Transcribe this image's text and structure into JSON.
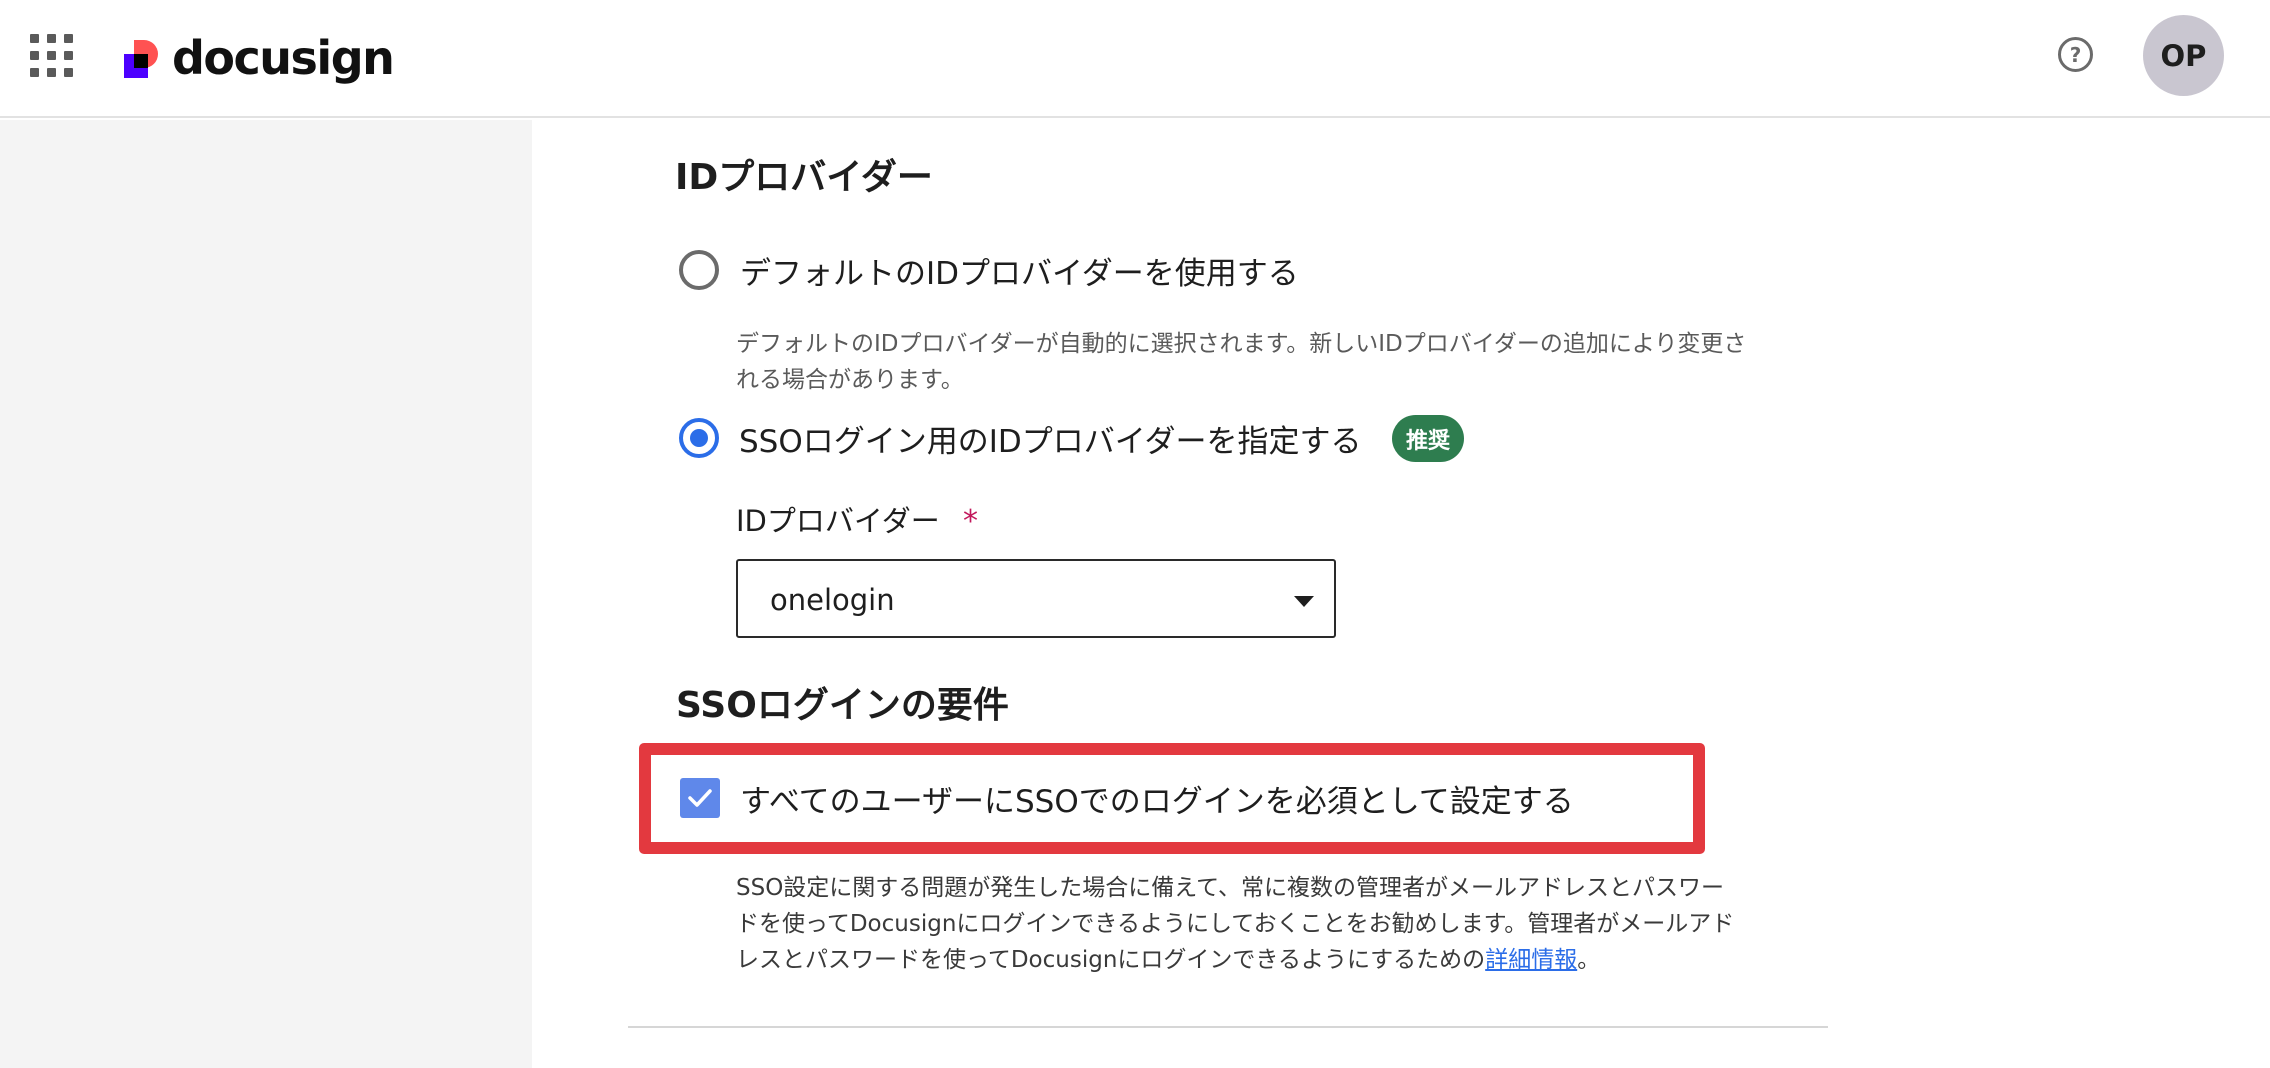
{
  "header": {
    "logo_text": "docusign",
    "help_icon_glyph": "?",
    "avatar_initials": "OP"
  },
  "identity_provider_section": {
    "title": "IDプロバイダー",
    "option_default": {
      "label": "デフォルトのIDプロバイダーを使用する",
      "selected": false,
      "description_line1": "デフォルトのIDプロバイダーが自動的に選択されます。新しいIDプロバイダーの追加により変更さ",
      "description_line2": "れる場合があります。"
    },
    "option_specify": {
      "label": "SSOログイン用のIDプロバイダーを指定する",
      "selected": true,
      "badge": "推奨"
    },
    "field": {
      "label": "IDプロバイダー",
      "required_mark": "*",
      "value": "onelogin"
    }
  },
  "sso_requirement_section": {
    "title": "SSOログインの要件",
    "checkbox": {
      "label": "すべてのユーザーにSSOでのログインを必須として設定する",
      "checked": true
    },
    "note_line1": "SSO設定に関する問題が発生した場合に備えて、常に複数の管理者がメールアドレスとパスワー",
    "note_line2": "ドを使ってDocusignにログインできるようにしておくことをお勧めします。管理者がメールアド",
    "note_line3_prefix": "レスとパスワードを使ってDocusignにログインできるようにするための",
    "note_link": "詳細情報",
    "note_line3_suffix": "。"
  },
  "colors": {
    "accent_blue": "#2b6de8",
    "badge_green": "#2e7d4f",
    "highlight_red": "#e3393f",
    "required_pink": "#c2185b"
  }
}
